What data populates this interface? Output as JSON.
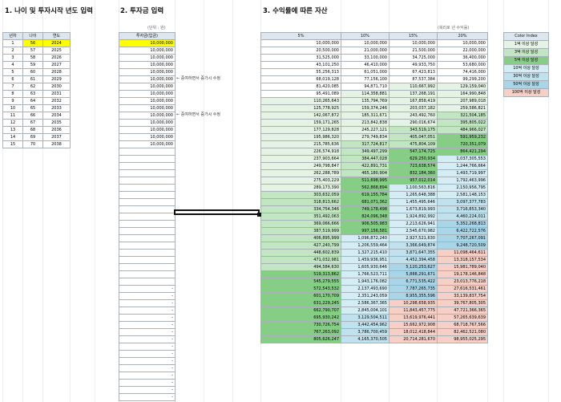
{
  "titles": {
    "age": "1. 나이 및 투자시작 년도 입력",
    "invest": "2. 투자금 입력",
    "assets": "3. 수익률에 따른 자산"
  },
  "units": {
    "invest": "(단위 : 원)",
    "assets": "(복리로 년 수익률)"
  },
  "age_table": {
    "headers": [
      "년차",
      "나이",
      "연도"
    ],
    "rows": [
      [
        "1",
        "56",
        "2024"
      ],
      [
        "2",
        "57",
        "2025"
      ],
      [
        "3",
        "58",
        "2026"
      ],
      [
        "4",
        "59",
        "2027"
      ],
      [
        "5",
        "60",
        "2028"
      ],
      [
        "6",
        "61",
        "2029"
      ],
      [
        "7",
        "62",
        "2030"
      ],
      [
        "8",
        "63",
        "2031"
      ],
      [
        "9",
        "64",
        "2032"
      ],
      [
        "10",
        "65",
        "2033"
      ],
      [
        "11",
        "66",
        "2034"
      ],
      [
        "12",
        "67",
        "2035"
      ],
      [
        "13",
        "68",
        "2036"
      ],
      [
        "14",
        "69",
        "2037"
      ],
      [
        "15",
        "70",
        "2038"
      ]
    ]
  },
  "invest_table": {
    "header": "투자금(입금)",
    "rows": [
      "10,000,000",
      "10,000,000",
      "10,000,000",
      "10,000,000",
      "10,000,000",
      "10,000,000",
      "10,000,000",
      "10,000,000",
      "10,000,000",
      "10,000,000",
      "10,000,000",
      "10,000,000",
      "10,000,000",
      "10,000,000",
      "10,000,000",
      "",
      "",
      "",
      "",
      "",
      "",
      "",
      "",
      "",
      "",
      "",
      "",
      "",
      "",
      "",
      "",
      "",
      "",
      "",
      "-",
      "-",
      "-",
      "-",
      "-",
      "-",
      "-",
      "-",
      "-",
      "-",
      "-",
      "-",
      "-",
      "-",
      "-",
      "-"
    ],
    "notes": [
      {
        "row": 5,
        "text": "← 중여하면서 증가시 수정"
      },
      {
        "row": 10,
        "text": "← 중여하면서 증가시 수정"
      }
    ]
  },
  "returns_table": {
    "headers": [
      "5%",
      "10%",
      "15%",
      "20%"
    ],
    "rows": [
      [
        "10,000,000",
        "10,000,000",
        "10,000,000",
        "10,000,000"
      ],
      [
        "20,500,000",
        "21,000,000",
        "21,500,000",
        "22,000,000"
      ],
      [
        "31,525,000",
        "33,100,000",
        "34,725,000",
        "36,400,000"
      ],
      [
        "43,101,250",
        "46,410,000",
        "49,933,750",
        "53,680,000"
      ],
      [
        "55,256,313",
        "61,051,000",
        "67,423,813",
        "74,416,000"
      ],
      [
        "68,019,128",
        "77,156,100",
        "87,537,384",
        "99,299,200"
      ],
      [
        "81,420,085",
        "94,871,710",
        "110,667,992",
        "129,159,040"
      ],
      [
        "95,491,089",
        "114,358,881",
        "137,268,191",
        "164,990,848"
      ],
      [
        "110,265,643",
        "135,794,769",
        "167,858,419",
        "207,989,018"
      ],
      [
        "125,778,925",
        "159,374,246",
        "203,037,182",
        "259,586,821"
      ],
      [
        "142,067,872",
        "185,311,671",
        "243,492,760",
        "321,504,185"
      ],
      [
        "159,171,265",
        "213,842,838",
        "290,016,674",
        "395,805,022"
      ],
      [
        "177,129,828",
        "245,227,121",
        "343,519,175",
        "484,966,027"
      ],
      [
        "195,986,320",
        "279,749,834",
        "405,047,051",
        "591,959,232"
      ],
      [
        "215,785,636",
        "317,724,817",
        "475,804,109",
        "720,351,079"
      ],
      [
        "226,574,918",
        "349,497,299",
        "547,174,725",
        "864,421,294"
      ],
      [
        "237,903,664",
        "384,447,028",
        "629,250,934",
        "1,037,305,553"
      ],
      [
        "249,798,847",
        "422,891,731",
        "723,638,574",
        "1,244,766,664"
      ],
      [
        "262,288,789",
        "465,180,904",
        "832,184,360",
        "1,493,719,997"
      ],
      [
        "275,403,229",
        "511,698,995",
        "957,012,014",
        "1,792,463,996"
      ],
      [
        "289,173,390",
        "562,868,894",
        "1,100,563,816",
        "2,150,956,795"
      ],
      [
        "303,632,059",
        "619,155,784",
        "1,265,648,388",
        "2,581,148,153"
      ],
      [
        "318,813,662",
        "681,071,362",
        "1,455,495,646",
        "3,097,377,783"
      ],
      [
        "334,754,346",
        "749,178,498",
        "1,673,819,993",
        "3,716,853,340"
      ],
      [
        "351,492,063",
        "824,096,348",
        "1,924,892,992",
        "4,460,224,011"
      ],
      [
        "369,066,666",
        "906,505,983",
        "2,213,626,941",
        "5,352,268,813"
      ],
      [
        "387,519,999",
        "997,156,581",
        "2,545,670,982",
        "6,422,722,576"
      ],
      [
        "406,895,999",
        "1,096,872,240",
        "2,927,521,630",
        "7,707,267,091"
      ],
      [
        "427,240,799",
        "1,206,559,464",
        "3,366,649,874",
        "9,248,720,509"
      ],
      [
        "448,602,839",
        "1,327,215,410",
        "3,871,647,355",
        "11,098,464,611"
      ],
      [
        "471,032,981",
        "1,459,936,951",
        "4,452,394,458",
        "13,318,157,534"
      ],
      [
        "494,584,630",
        "1,605,930,646",
        "5,120,253,627",
        "15,981,789,040"
      ],
      [
        "519,313,862",
        "1,766,523,711",
        "5,888,291,671",
        "19,178,146,848"
      ],
      [
        "545,279,555",
        "1,943,176,082",
        "6,771,535,422",
        "23,013,776,218"
      ],
      [
        "572,543,532",
        "2,137,493,690",
        "7,787,265,735",
        "27,616,531,461"
      ],
      [
        "601,170,709",
        "2,351,243,059",
        "8,955,355,596",
        "33,139,837,754"
      ],
      [
        "631,229,245",
        "2,586,367,365",
        "10,298,658,935",
        "39,767,805,305"
      ],
      [
        "662,790,707",
        "2,845,004,101",
        "11,843,457,775",
        "47,721,366,365"
      ],
      [
        "695,930,242",
        "3,129,504,511",
        "13,619,976,441",
        "57,265,639,639"
      ],
      [
        "730,726,754",
        "3,442,454,962",
        "15,662,972,908",
        "68,718,767,566"
      ],
      [
        "767,263,092",
        "3,786,700,459",
        "18,012,418,844",
        "82,462,521,080"
      ],
      [
        "805,626,247",
        "4,165,370,505",
        "20,714,281,670",
        "98,955,025,295"
      ]
    ]
  },
  "legend": {
    "header": "Color Index",
    "items": [
      "1억 이상 달성",
      "3억 이상 달성",
      "5억 이상 달성",
      "10억 이상 달성",
      "30억 이상 달성",
      "50억 이상 달성",
      "100억 이상 달성"
    ],
    "colors": [
      "#e4f3e4",
      "#c2e6c2",
      "#86cd86",
      "#d4ecf4",
      "#bfe2ee",
      "#a8d6e8",
      "#f6cfc6"
    ]
  },
  "tier_colors": {
    "none": "#ffffff",
    "t1": "#e4f3e4",
    "t3": "#c2e6c2",
    "t5": "#86cd86",
    "t10": "#d4ecf4",
    "t30": "#bfe2ee",
    "t50": "#a8d6e8",
    "t100": "#f6cfc6"
  },
  "highlight": "#ffff00"
}
